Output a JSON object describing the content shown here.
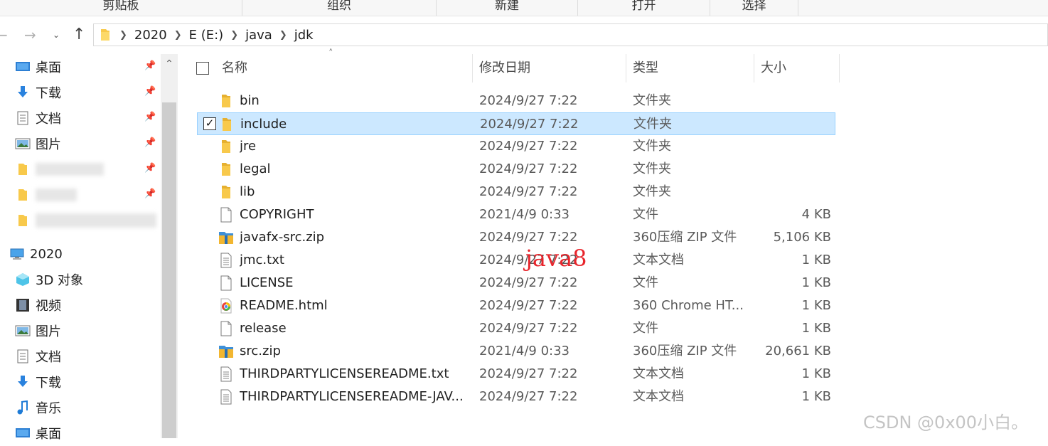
{
  "ribbon": {
    "groups": [
      {
        "label": "剪贴板"
      },
      {
        "label": "组织"
      },
      {
        "label": "新建"
      },
      {
        "label": "打开"
      },
      {
        "label": "选择"
      }
    ]
  },
  "breadcrumb": {
    "items": [
      "2020",
      "E (E:)",
      "java",
      "jdk"
    ]
  },
  "nav_pane": {
    "quick_access": [
      {
        "label": "桌面",
        "icon": "desktop-icon",
        "pinned": true
      },
      {
        "label": "下载",
        "icon": "download-icon",
        "pinned": true
      },
      {
        "label": "文档",
        "icon": "document-icon",
        "pinned": true
      },
      {
        "label": "图片",
        "icon": "picture-icon",
        "pinned": true
      }
    ],
    "this_pc": {
      "label": "2020",
      "icon": "computer-icon",
      "items": [
        {
          "label": "3D 对象",
          "icon": "3d-objects-icon"
        },
        {
          "label": "视频",
          "icon": "video-icon"
        },
        {
          "label": "图片",
          "icon": "picture-icon"
        },
        {
          "label": "文档",
          "icon": "document-icon"
        },
        {
          "label": "下载",
          "icon": "download-icon"
        },
        {
          "label": "音乐",
          "icon": "music-icon"
        },
        {
          "label": "桌面",
          "icon": "desktop-icon"
        }
      ]
    }
  },
  "columns": {
    "name": "名称",
    "date": "修改日期",
    "type": "类型",
    "size": "大小"
  },
  "files": [
    {
      "name": "bin",
      "date": "2024/9/27 7:22",
      "type": "文件夹",
      "size": "",
      "icon": "folder-icon",
      "selected": false
    },
    {
      "name": "include",
      "date": "2024/9/27 7:22",
      "type": "文件夹",
      "size": "",
      "icon": "folder-icon",
      "selected": true
    },
    {
      "name": "jre",
      "date": "2024/9/27 7:22",
      "type": "文件夹",
      "size": "",
      "icon": "folder-icon",
      "selected": false
    },
    {
      "name": "legal",
      "date": "2024/9/27 7:22",
      "type": "文件夹",
      "size": "",
      "icon": "folder-icon",
      "selected": false
    },
    {
      "name": "lib",
      "date": "2024/9/27 7:22",
      "type": "文件夹",
      "size": "",
      "icon": "folder-icon",
      "selected": false
    },
    {
      "name": "COPYRIGHT",
      "date": "2021/4/9 0:33",
      "type": "文件",
      "size": "4 KB",
      "icon": "file-icon",
      "selected": false
    },
    {
      "name": "javafx-src.zip",
      "date": "2024/9/27 7:22",
      "type": "360压缩 ZIP 文件",
      "size": "5,106 KB",
      "icon": "zip-icon",
      "selected": false
    },
    {
      "name": "jmc.txt",
      "date": "2024/9/27 7:22",
      "type": "文本文档",
      "size": "1 KB",
      "icon": "text-file-icon",
      "selected": false
    },
    {
      "name": "LICENSE",
      "date": "2024/9/27 7:22",
      "type": "文件",
      "size": "1 KB",
      "icon": "file-icon",
      "selected": false
    },
    {
      "name": "README.html",
      "date": "2024/9/27 7:22",
      "type": "360 Chrome HT...",
      "size": "1 KB",
      "icon": "browser-html-icon",
      "selected": false
    },
    {
      "name": "release",
      "date": "2024/9/27 7:22",
      "type": "文件",
      "size": "1 KB",
      "icon": "file-icon",
      "selected": false
    },
    {
      "name": "src.zip",
      "date": "2021/4/9 0:33",
      "type": "360压缩 ZIP 文件",
      "size": "20,661 KB",
      "icon": "zip-icon",
      "selected": false
    },
    {
      "name": "THIRDPARTYLICENSEREADME.txt",
      "date": "2024/9/27 7:22",
      "type": "文本文档",
      "size": "1 KB",
      "icon": "text-file-icon",
      "selected": false
    },
    {
      "name": "THIRDPARTYLICENSEREADME-JAV...",
      "date": "2024/9/27 7:22",
      "type": "文本文档",
      "size": "1 KB",
      "icon": "text-file-icon",
      "selected": false
    }
  ],
  "annotation": "java8",
  "watermark": "CSDN @0x00小白。",
  "colors": {
    "selection_bg": "#cce8ff",
    "selection_border": "#99d1ff",
    "annotation": "#e8242b",
    "folder": "#f8c94b"
  }
}
